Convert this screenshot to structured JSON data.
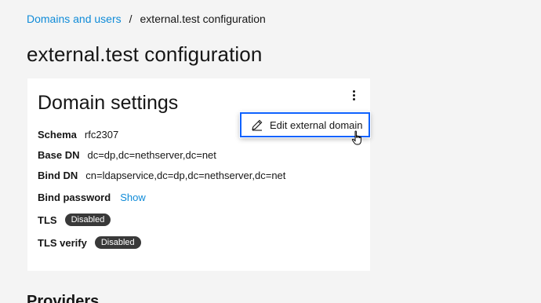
{
  "breadcrumb": {
    "parent": "Domains and users",
    "separator": "/",
    "current": "external.test configuration"
  },
  "page": {
    "title": "external.test configuration"
  },
  "card": {
    "title": "Domain settings",
    "overflow_icon": "overflow-menu-vertical-icon",
    "fields": {
      "schema": {
        "label": "Schema",
        "value": "rfc2307"
      },
      "base_dn": {
        "label": "Base DN",
        "value": "dc=dp,dc=nethserver,dc=net"
      },
      "bind_dn": {
        "label": "Bind DN",
        "value": "cn=ldapservice,dc=dp,dc=nethserver,dc=net"
      },
      "bind_password": {
        "label": "Bind password",
        "action": "Show"
      },
      "tls": {
        "label": "TLS",
        "badge": "Disabled"
      },
      "tls_verify": {
        "label": "TLS verify",
        "badge": "Disabled"
      }
    }
  },
  "menu": {
    "item_label": "Edit external domain",
    "item_icon": "edit-pencil-icon"
  },
  "next_section": {
    "title": "Providers"
  },
  "colors": {
    "link": "#0f8bd8",
    "focus": "#0f62fe",
    "badge_bg": "#393939"
  }
}
